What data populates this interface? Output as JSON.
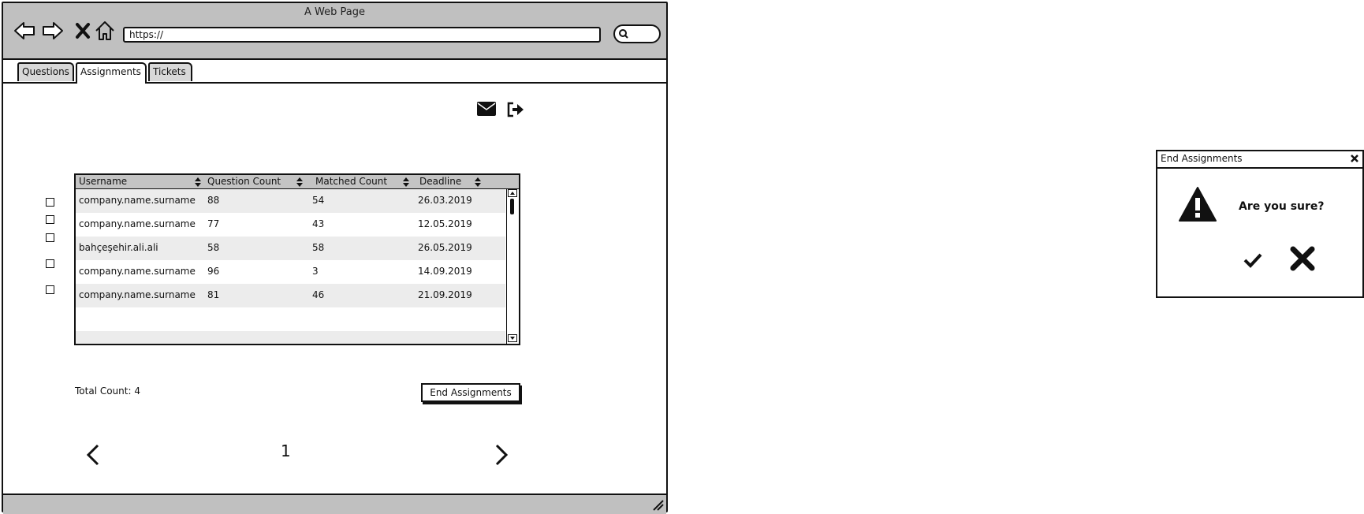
{
  "window": {
    "title": "A Web Page",
    "url": "https://"
  },
  "tabs": [
    {
      "label": "Questions",
      "active": false
    },
    {
      "label": "Assignments",
      "active": true
    },
    {
      "label": "Tickets",
      "active": false
    }
  ],
  "icons": {
    "back": "back-arrow-icon",
    "forward": "forward-arrow-icon",
    "stop": "close-icon",
    "home": "home-icon",
    "search": "search-icon",
    "mail": "envelope-icon",
    "logout": "sign-out-icon",
    "sort": "sort-icon",
    "prev": "chevron-left-icon",
    "next": "chevron-right-icon",
    "warning": "warning-icon",
    "confirm": "check-icon",
    "cancel": "close-icon"
  },
  "table": {
    "columns": [
      "Username",
      "Question Count",
      "Matched Count",
      "Deadline"
    ],
    "rows": [
      [
        "company.name.surname",
        "88",
        "54",
        "26.03.2019"
      ],
      [
        "company.name.surname",
        "77",
        "43",
        "12.05.2019"
      ],
      [
        "bahçeşehir.ali.ali",
        "58",
        "58",
        "26.05.2019"
      ],
      [
        "company.name.surname",
        "96",
        "3",
        "14.09.2019"
      ],
      [
        "company.name.surname",
        "81",
        "46",
        "21.09.2019"
      ]
    ]
  },
  "footer": {
    "total_count": "Total Count: 4",
    "end_button": "End Assignments"
  },
  "pagination": {
    "current_page": "1"
  },
  "dialog": {
    "title": "End Assignments",
    "message": "Are you sure?"
  }
}
